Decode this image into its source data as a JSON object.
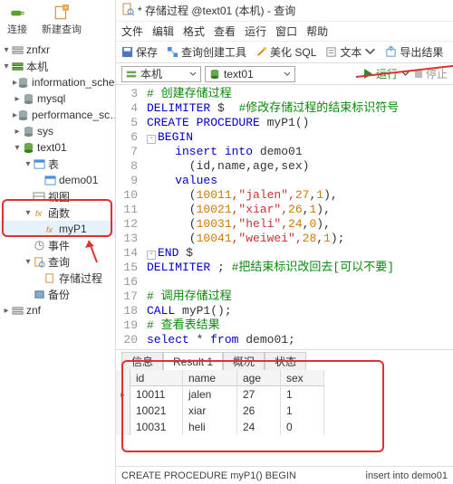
{
  "left_toolbar": {
    "connect": "连接",
    "new_query": "新建查询"
  },
  "tree": {
    "znfxr": "znfxr",
    "localhost": "本机",
    "db_info": "information_sche…",
    "db_mysql": "mysql",
    "db_perf": "performance_sc…",
    "db_sys": "sys",
    "db_text01": "text01",
    "tables": "表",
    "tbl_demo01": "demo01",
    "views": "视图",
    "functions": "函数",
    "fn_myp1": "myP1",
    "events": "事件",
    "queries": "查询",
    "q_sp": "存储过程",
    "backups": "备份",
    "znf": "znf"
  },
  "title": "* 存储过程 @text01 (本机) - 查询",
  "menu": {
    "file": "文件",
    "edit": "编辑",
    "format": "格式",
    "view": "查看",
    "run": "运行",
    "window": "窗口",
    "help": "帮助"
  },
  "toolbar": {
    "save": "保存",
    "qb": "查询创建工具",
    "beautify": "美化 SQL",
    "text": "文本",
    "export": "导出结果"
  },
  "context": {
    "conn": "本机",
    "db": "text01",
    "run": "运行",
    "stop": "停止"
  },
  "code": {
    "l3": "# 创建存储过程",
    "l4a": "DELIMITER",
    "l4b": " $  ",
    "l4c": "#修改存储过程的结束标识符号",
    "l5a": "CREATE PROCEDURE",
    "l5b": " myP1()",
    "l6": "BEGIN",
    "l7a": "    insert into",
    "l7b": " demo01",
    "l8": "      (id,name,age,sex)",
    "l9": "    values",
    "l10a": "      (",
    "l10b": "10011",
    "l10c": ",\"jalen\",",
    "l10d": "27",
    "l10e": ",",
    "l10f": "1",
    "l10g": "),",
    "l11a": "      (",
    "l11b": "10021",
    "l11c": ",\"xiar\",",
    "l11d": "26",
    "l11e": ",",
    "l11f": "1",
    "l11g": "),",
    "l12a": "      (",
    "l12b": "10031",
    "l12c": ",\"heli\",",
    "l12d": "24",
    "l12e": ",",
    "l12f": "0",
    "l12g": "),",
    "l13a": "      (",
    "l13b": "10041",
    "l13c": ",\"weiwei\",",
    "l13d": "28",
    "l13e": ",",
    "l13f": "1",
    "l13g": ");",
    "l14a": "END",
    "l14b": " $",
    "l15a": "DELIMITER",
    "l15b": " ; ",
    "l15c": "#把结束标识改回去[可以不要]",
    "l17": "# 调用存储过程",
    "l18a": "CALL",
    "l18b": " myP1();",
    "l19": "# 查看表结果",
    "l20a": "select",
    "l20b": " * ",
    "l20c": "from",
    "l20d": " demo01;"
  },
  "tabs": {
    "info": "信息",
    "result": "Result 1",
    "summary": "概况",
    "status": "状态"
  },
  "grid": {
    "h_id": "id",
    "h_name": "name",
    "h_age": "age",
    "h_sex": "sex",
    "r1": {
      "id": "10011",
      "name": "jalen",
      "age": "27",
      "sex": "1"
    },
    "r2": {
      "id": "10021",
      "name": "xiar",
      "age": "26",
      "sex": "1"
    },
    "r3": {
      "id": "10031",
      "name": "heli",
      "age": "24",
      "sex": "0"
    }
  },
  "status": {
    "left": "CREATE PROCEDURE myP1() BEGIN",
    "right": "insert into demo01"
  }
}
